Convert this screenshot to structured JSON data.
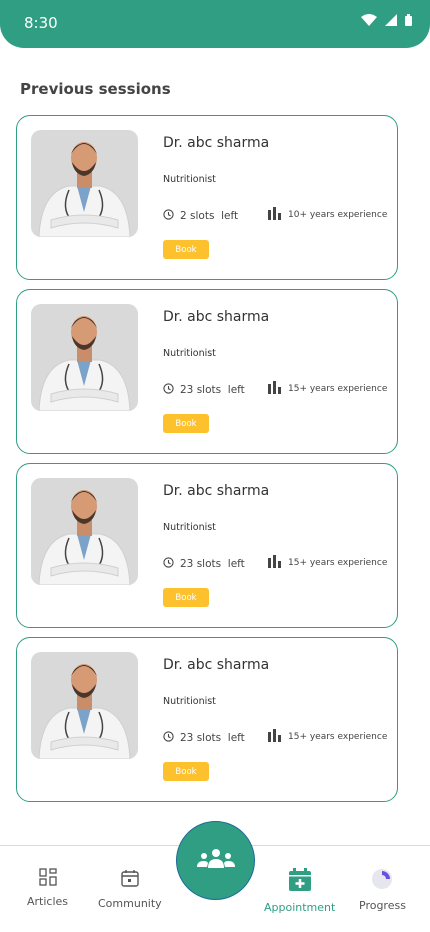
{
  "status_bar": {
    "time": "8:30",
    "icons": [
      "wifi-icon",
      "signal-icon",
      "battery-icon"
    ]
  },
  "section_title": "Previous sessions",
  "sessions": [
    {
      "name": "Dr. abc sharma",
      "role": "Nutritionist",
      "slots": "2 slots  left",
      "experience": "10+ years experience",
      "book_label": "Book"
    },
    {
      "name": "Dr. abc sharma",
      "role": "Nutritionist",
      "slots": "23 slots  left",
      "experience": "15+ years experience",
      "book_label": "Book"
    },
    {
      "name": "Dr. abc sharma",
      "role": "Nutritionist",
      "slots": "23 slots  left",
      "experience": "15+ years experience",
      "book_label": "Book"
    },
    {
      "name": "Dr. abc sharma",
      "role": "Nutritionist",
      "slots": "23 slots  left",
      "experience": "15+ years experience",
      "book_label": "Book"
    }
  ],
  "bottom_nav": {
    "items": [
      {
        "label": "Articles",
        "icon": "grid-icon"
      },
      {
        "label": "Community",
        "icon": "calendar-icon"
      },
      {
        "label": "Appointment",
        "icon": "calendar-plus-icon",
        "active": true
      },
      {
        "label": "Progress",
        "icon": "pie-chart-icon"
      }
    ],
    "center_icon": "group-icon"
  },
  "colors": {
    "primary": "#2f9e83",
    "accent": "#fcc12d",
    "photo_bg": "#d9d9d9"
  }
}
